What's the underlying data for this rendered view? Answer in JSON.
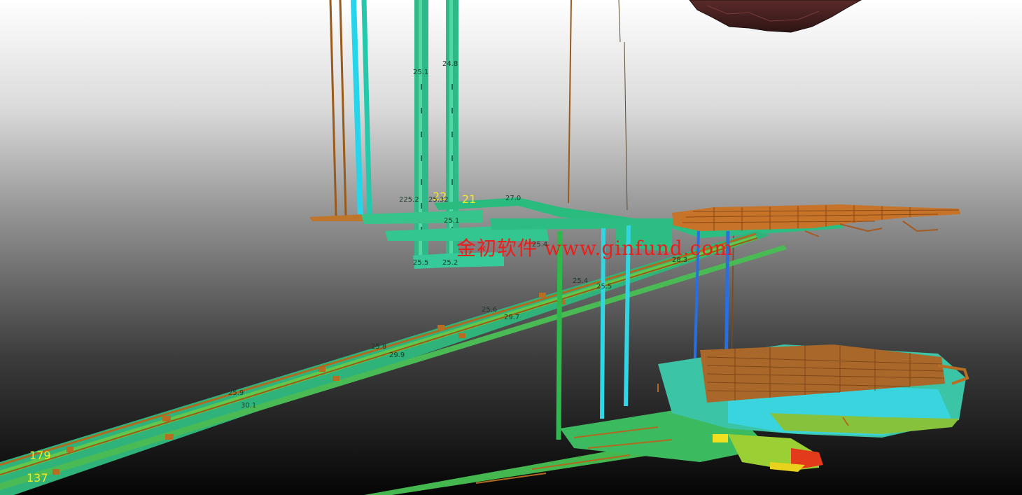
{
  "scene": {
    "watermark": "金初软件 www.ginfund.com",
    "labels": {
      "l_25_1": "25.1",
      "l_24_8": "24.8",
      "l_27_0": "27.0",
      "l_21": "21",
      "l_22": "22",
      "l_225": "225.2",
      "l_2532": "25.32",
      "l_25_1b": "25.1",
      "l_25_4": "25.4",
      "l_25_6": "25.6",
      "l_25_8": "25.8",
      "l_25_9": "25.9",
      "l_29_7": "29.7",
      "l_29_9": "29.9",
      "l_30_1": "30.1",
      "l_25_4b": "25.4",
      "l_25_5": "25.5",
      "l_28_3": "28.3",
      "l_25_2": "25.2",
      "l_25_5b": "25.5",
      "l_179": "179",
      "l_137": "137"
    }
  }
}
